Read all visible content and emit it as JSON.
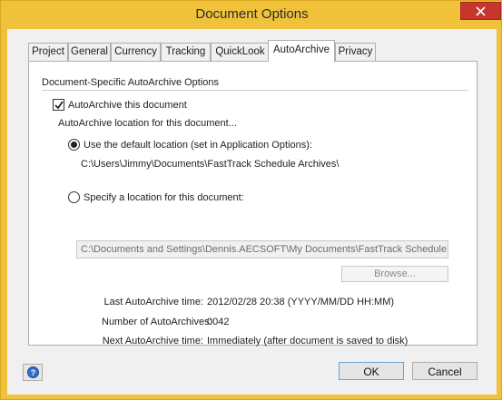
{
  "window": {
    "title": "Document Options"
  },
  "tabs": [
    {
      "label": "Project"
    },
    {
      "label": "General"
    },
    {
      "label": "Currency"
    },
    {
      "label": "Tracking"
    },
    {
      "label": "QuickLook"
    },
    {
      "label": "AutoArchive"
    },
    {
      "label": "Privacy"
    }
  ],
  "active_tab": "AutoArchive",
  "autoarchive": {
    "section_title": "Document-Specific AutoArchive Options",
    "enable_label": "AutoArchive this document",
    "enable_checked": true,
    "location_heading": "AutoArchive location for this document...",
    "default_option_label": "Use the default location (set in Application Options):",
    "default_selected": true,
    "default_path": "C:\\Users\\Jimmy\\Documents\\FastTrack Schedule Archives\\",
    "specify_option_label": "Specify a location for this document:",
    "specify_path_value": "C:\\Documents and Settings\\Dennis.AECSOFT\\My Documents\\FastTrack Schedule",
    "browse_label": "Browse..."
  },
  "info": {
    "last_label": "Last AutoArchive time:",
    "last_value": "2012/02/28 20:38 (YYYY/MM/DD HH:MM)",
    "count_label": "Number of AutoArchives:",
    "count_value": "0042",
    "next_label": "Next AutoArchive time:",
    "next_value": "Immediately (after document is saved to disk)"
  },
  "footer": {
    "help_icon": "?",
    "ok_label": "OK",
    "cancel_label": "Cancel"
  },
  "colors": {
    "frame": "#f0c23b",
    "close_button": "#c7352b",
    "help_icon": "#2f6cc9"
  }
}
